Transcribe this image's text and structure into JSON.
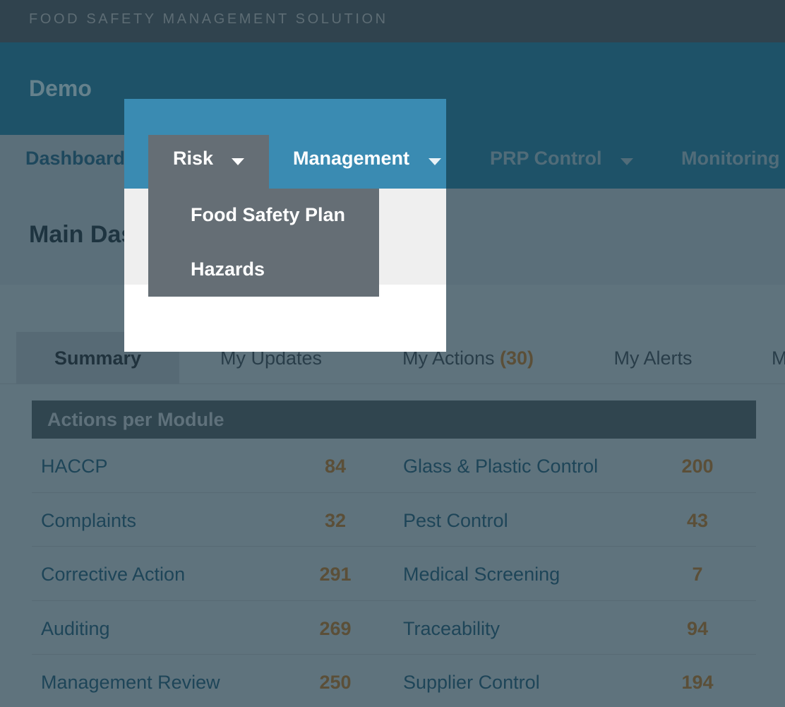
{
  "topbar": {
    "title": "FOOD SAFETY MANAGEMENT SOLUTION"
  },
  "header": {
    "title": "Demo"
  },
  "nav": {
    "items": [
      {
        "label": "Dashboard"
      },
      {
        "label": "Risk"
      },
      {
        "label": "Management"
      },
      {
        "label": "PRP Control"
      },
      {
        "label": "Monitoring"
      }
    ]
  },
  "risk_menu": {
    "items": [
      {
        "label": "Food Safety Plan"
      },
      {
        "label": "Hazards"
      }
    ]
  },
  "page": {
    "title": "Main Dashboard"
  },
  "tabs": [
    {
      "label": "Summary",
      "active": true
    },
    {
      "label": "My Updates"
    },
    {
      "label": "My Actions",
      "count": "(30)"
    },
    {
      "label": "My Alerts"
    },
    {
      "label": "M"
    }
  ],
  "panel": {
    "title": "Actions per Module",
    "left": [
      {
        "label": "HACCP",
        "value": "84"
      },
      {
        "label": "Complaints",
        "value": "32"
      },
      {
        "label": "Corrective Action",
        "value": "291"
      },
      {
        "label": "Auditing",
        "value": "269"
      },
      {
        "label": "Management Review",
        "value": "250"
      }
    ],
    "right": [
      {
        "label": "Glass & Plastic Control",
        "value": "200"
      },
      {
        "label": "Pest Control",
        "value": "43"
      },
      {
        "label": "Medical Screening",
        "value": "7"
      },
      {
        "label": "Traceability",
        "value": "94"
      },
      {
        "label": "Supplier Control",
        "value": "194"
      }
    ]
  },
  "colors": {
    "header_blue": "#2f7ea0",
    "highlight_blue": "#3a8bb2",
    "menu_gray": "#656e75",
    "count_brown": "#8c7a56"
  }
}
